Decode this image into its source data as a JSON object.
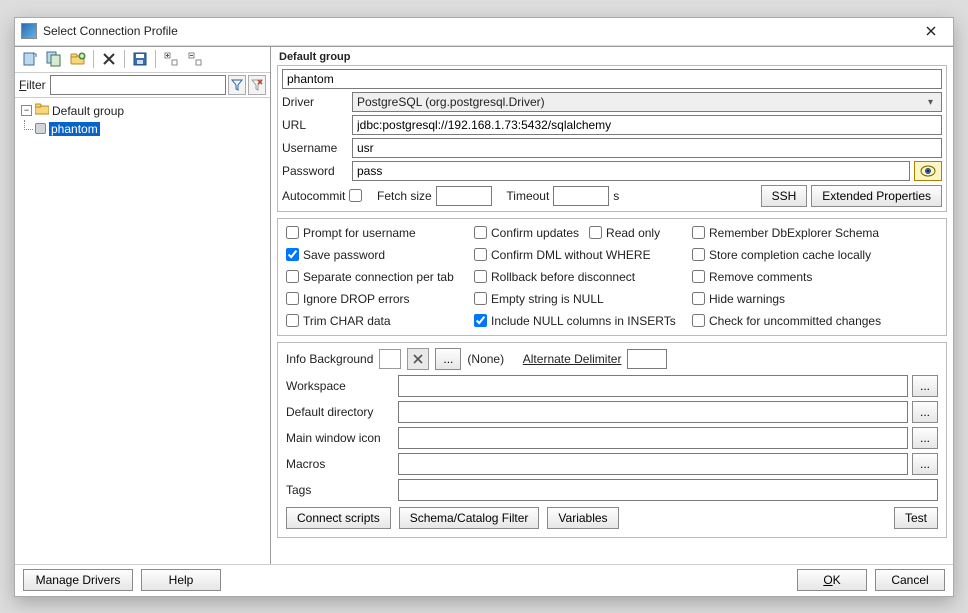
{
  "window": {
    "title": "Select Connection Profile"
  },
  "toolbar_icons": {
    "new_profile": "new-profile-icon",
    "copy_profile": "copy-profile-icon",
    "new_group": "new-group-icon",
    "delete": "delete-icon",
    "save": "save-icon",
    "expand": "expand-icon",
    "collapse": "collapse-icon"
  },
  "filter": {
    "label": "Filter",
    "value": ""
  },
  "tree": {
    "group": "Default group",
    "items": [
      {
        "name": "phantom",
        "selected": true
      }
    ]
  },
  "right": {
    "group_label": "Default group",
    "profile_name": "phantom",
    "driver_label": "Driver",
    "driver_value": "PostgreSQL (org.postgresql.Driver)",
    "url_label": "URL",
    "url_value": "jdbc:postgresql://192.168.1.73:5432/sqlalchemy",
    "username_label": "Username",
    "username_value": "usr",
    "password_label": "Password",
    "password_value": "pass",
    "autocommit": "Autocommit",
    "fetch_size": "Fetch size",
    "timeout": "Timeout",
    "timeout_unit": "s",
    "ssh": "SSH",
    "ext_props": "Extended Properties",
    "checks": [
      {
        "id": "prompt_user",
        "label": "Prompt for username",
        "checked": false
      },
      {
        "id": "confirm_updates",
        "label": "Confirm updates",
        "checked": false
      },
      {
        "id": "read_only",
        "label": "Read only",
        "checked": false
      },
      {
        "id": "remember_schema",
        "label": "Remember DbExplorer Schema",
        "checked": false
      },
      {
        "id": "save_password",
        "label": "Save password",
        "checked": true
      },
      {
        "id": "confirm_dml",
        "label": "Confirm DML without WHERE",
        "checked": false
      },
      {
        "id": "spacer1",
        "label": "",
        "checked": false,
        "blank": true
      },
      {
        "id": "store_cache",
        "label": "Store completion cache locally",
        "checked": false
      },
      {
        "id": "sep_conn",
        "label": "Separate connection per tab",
        "checked": false
      },
      {
        "id": "rollback",
        "label": "Rollback before disconnect",
        "checked": false
      },
      {
        "id": "spacer2",
        "label": "",
        "checked": false,
        "blank": true
      },
      {
        "id": "remove_comments",
        "label": "Remove comments",
        "checked": false
      },
      {
        "id": "ignore_drop",
        "label": "Ignore DROP errors",
        "checked": false
      },
      {
        "id": "empty_null",
        "label": "Empty string is NULL",
        "checked": false
      },
      {
        "id": "spacer3",
        "label": "",
        "checked": false,
        "blank": true
      },
      {
        "id": "hide_warn",
        "label": "Hide warnings",
        "checked": false
      },
      {
        "id": "trim_char",
        "label": "Trim CHAR data",
        "checked": false
      },
      {
        "id": "include_null",
        "label": "Include NULL columns in INSERTs",
        "checked": true
      },
      {
        "id": "spacer4",
        "label": "",
        "checked": false,
        "blank": true
      },
      {
        "id": "check_uncommitted",
        "label": "Check for uncommitted changes",
        "checked": false
      }
    ],
    "info_bg": "Info Background",
    "none": "(None)",
    "alt_delim": "Alternate Delimiter",
    "workspace": "Workspace",
    "default_dir": "Default directory",
    "main_icon": "Main window icon",
    "macros": "Macros",
    "tags": "Tags",
    "connect_scripts": "Connect scripts",
    "schema_filter": "Schema/Catalog Filter",
    "variables": "Variables",
    "test": "Test"
  },
  "bottom": {
    "manage": "Manage Drivers",
    "help": "Help",
    "ok": "OK",
    "cancel": "Cancel"
  }
}
